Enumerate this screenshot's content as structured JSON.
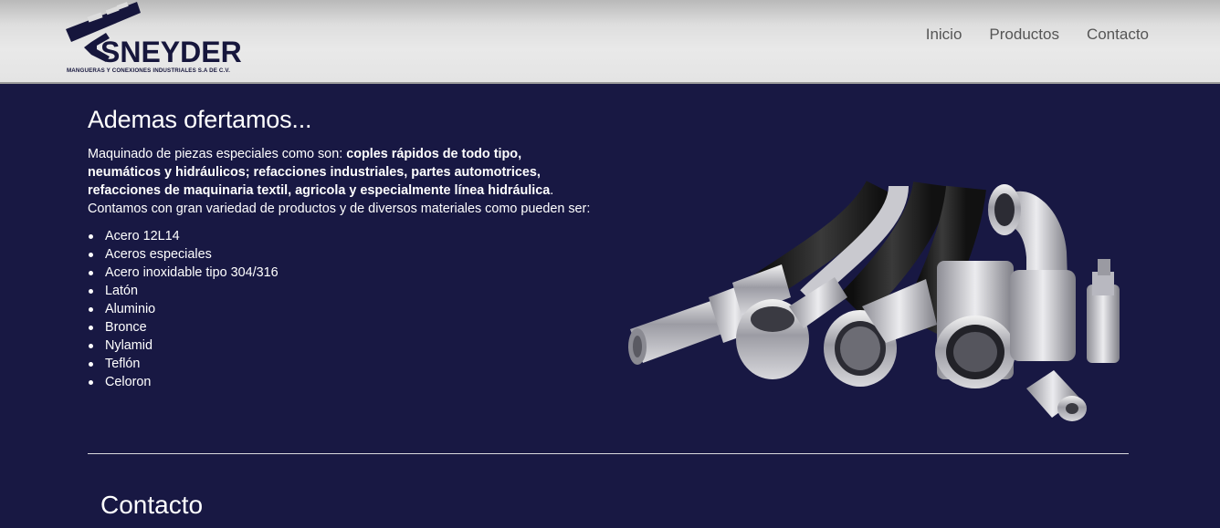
{
  "header": {
    "logo_text": "SNEYDER",
    "logo_tagline": "MANGUERAS Y CONEXIONES INDUSTRIALES S.A DE C.V.",
    "nav": [
      {
        "label": "Inicio"
      },
      {
        "label": "Productos"
      },
      {
        "label": "Contacto"
      }
    ]
  },
  "main": {
    "title": "Ademas ofertamos...",
    "description": {
      "intro": "Maquinado de piezas especiales como son: ",
      "bold": "coples rápidos de todo tipo, neumáticos y hidráulicos; refacciones industriales, partes automotrices, refacciones de maquinaria textil, agricola y especialmente línea hidráulica",
      "outro": ". Contamos con gran variedad de productos y de diversos materiales como pueden ser:"
    },
    "materials": [
      "Acero 12L14",
      "Aceros especiales",
      "Acero inoxidable tipo 304/316",
      "Latón",
      "Aluminio",
      "Bronce",
      "Nylamid",
      "Teflón",
      "Celoron"
    ]
  },
  "contact": {
    "title": "Contacto"
  },
  "colors": {
    "background": "#181843",
    "header_gray": "#e4e4e4",
    "logo_navy": "#16163c",
    "nav_text": "#555555"
  }
}
